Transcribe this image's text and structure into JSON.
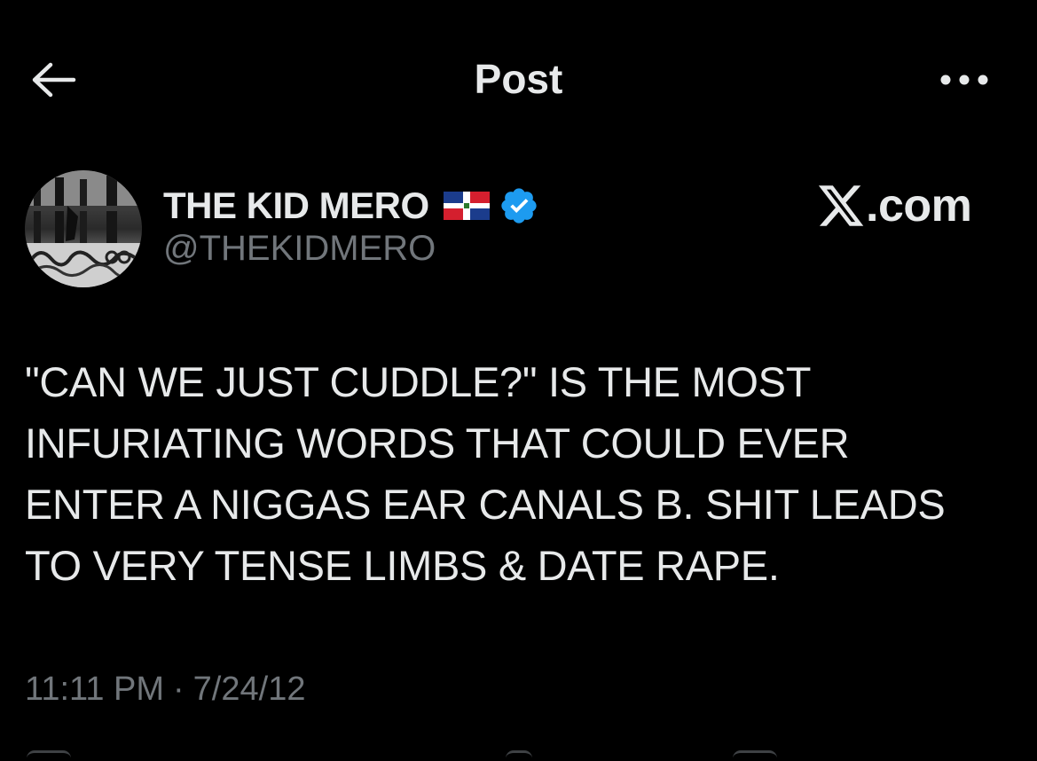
{
  "header": {
    "title": "Post",
    "back_icon": "arrow-left-icon",
    "more_icon": "more-horizontal-icon"
  },
  "author": {
    "name": "THE KID MERO",
    "handle": "@THEKIDMERO",
    "flag_icon": "dominican-republic-flag-icon",
    "verified_icon": "verified-badge-icon",
    "verified_color": "#1d9bf0"
  },
  "watermark": {
    "text": ".com",
    "icon": "x-logo-icon"
  },
  "tweet": {
    "text": "\"CAN WE JUST CUDDLE?\" IS THE MOST\nINFURIATING WORDS THAT COULD EVER\nENTER A NIGGAS EAR CANALS B. SHIT LEADS\nTO VERY TENSE LIMBS & DATE RAPE.",
    "time": "11:11 PM",
    "separator": "·",
    "date": "7/24/12"
  },
  "colors": {
    "background": "#000000",
    "primary_text": "#e7e9ea",
    "secondary_text": "#71767b"
  }
}
